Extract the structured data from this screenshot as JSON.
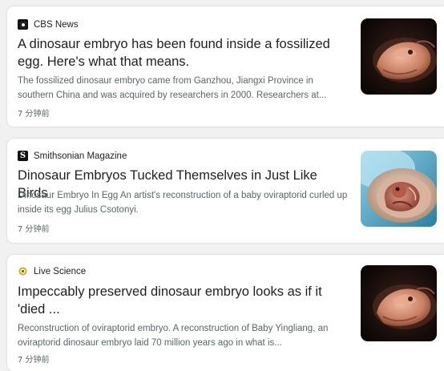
{
  "articles": [
    {
      "source": "CBS News",
      "source_icon": "cbs-eye-logo-icon",
      "title": "A dinosaur embryo has been found inside a fossilized egg. Here's what that means.",
      "snippet": "The fossilized dinosaur embryo came from Ganzhou, Jiangxi Province in southern China and was acquired by researchers in 2000. Researchers at...",
      "time": "7 分钟前",
      "thumbnail": "dinosaur-embryo-dark-image"
    },
    {
      "source": "Smithsonian Magazine",
      "source_icon": "smithsonian-s-logo-icon",
      "source_logo_letter": "S",
      "title": "Dinosaur Embryos Tucked Themselves in Just Like Birds",
      "snippet": "Dinosaur Embryo In Egg An artist's reconstruction of a baby oviraptorid curled up inside its egg Julius Csotonyi.",
      "time": "7 分钟前",
      "thumbnail": "embryo-in-blue-egg-image"
    },
    {
      "source": "Live Science",
      "source_icon": "live-science-logo-icon",
      "title": "Impeccably preserved dinosaur embryo looks as if it 'died ...",
      "snippet": "Reconstruction of oviraptorid embryo. A reconstruction of Baby Yingliang, an oviraptorid dinosaur embryo laid 70 million years ago in what is...",
      "time": "7 分钟前",
      "thumbnail": "dinosaur-embryo-dark-image"
    }
  ]
}
